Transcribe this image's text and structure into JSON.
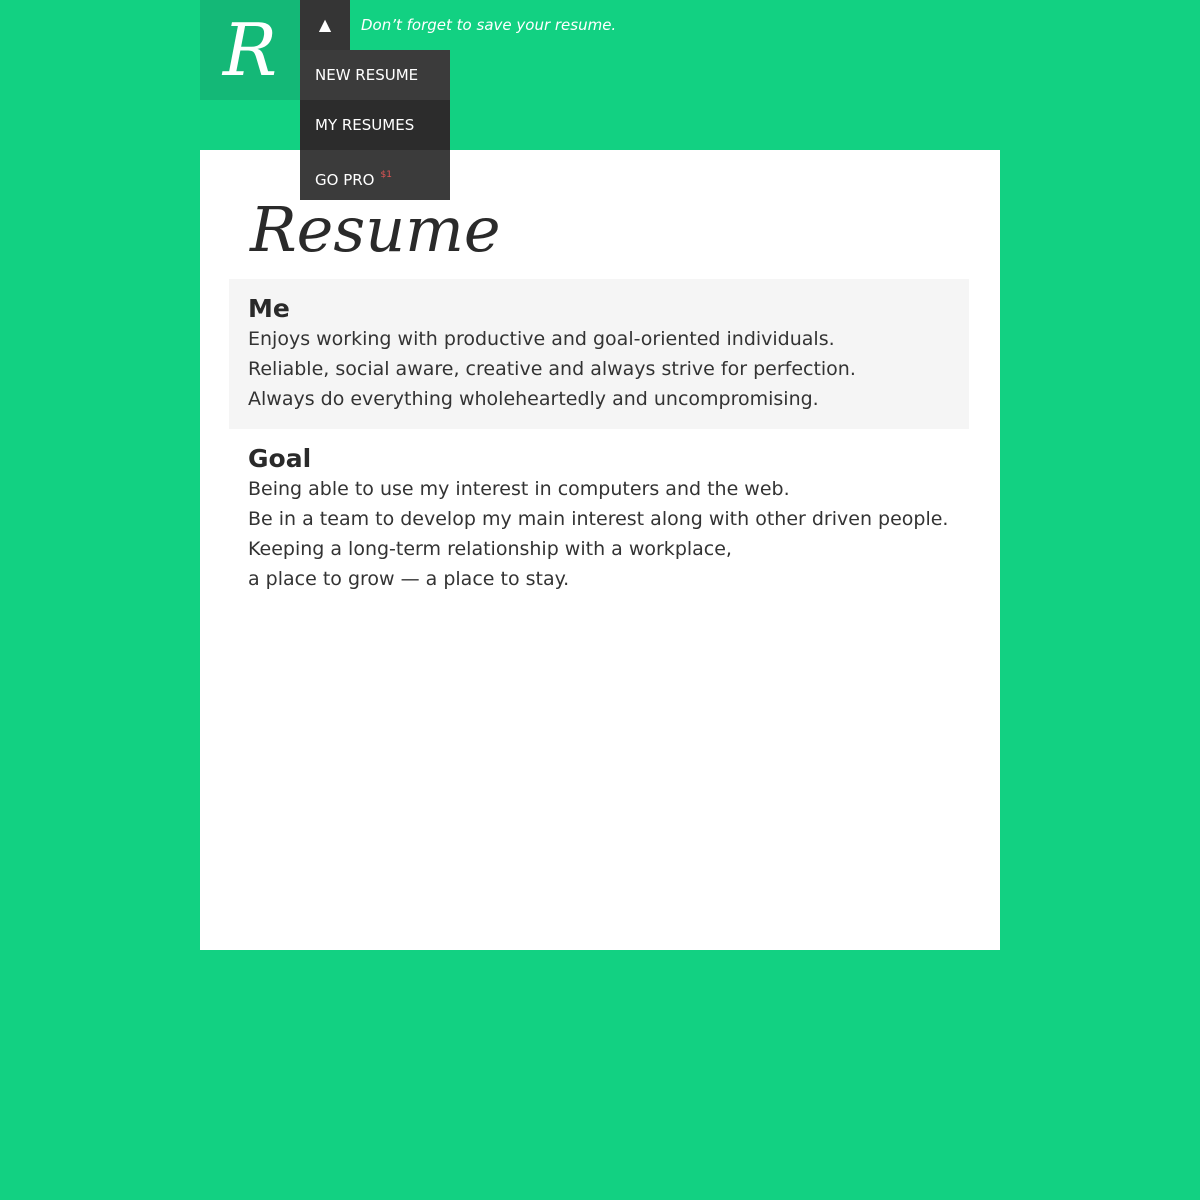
{
  "header": {
    "logo_letter": "R",
    "toggle_glyph": "▲",
    "notice": "Don’t forget to save your resume."
  },
  "menu": {
    "items": [
      {
        "label": "NEW RESUME"
      },
      {
        "label": "MY RESUMES"
      },
      {
        "label": "GO PRO",
        "badge": "$1"
      }
    ]
  },
  "resume": {
    "title": "Resume",
    "sections": [
      {
        "heading": "Me",
        "lines": [
          "Enjoys working with productive and goal-oriented individuals.",
          "Reliable, social aware, creative and always strive for perfection.",
          "Always do everything wholeheartedly and uncompromising."
        ]
      },
      {
        "heading": "Goal",
        "lines": [
          "Being able to use my interest in computers and the web.",
          "Be in a team to develop my main interest along with other driven people.",
          "Keeping a long-term relationship with  a workplace,",
          "a place to grow — a place to stay."
        ]
      }
    ]
  },
  "colors": {
    "background": "#12d182",
    "logo_background": "#14b877",
    "menu_background": "#3b3b3b",
    "menu_active_background": "#2c2c2c",
    "price_badge": "#e05555"
  }
}
